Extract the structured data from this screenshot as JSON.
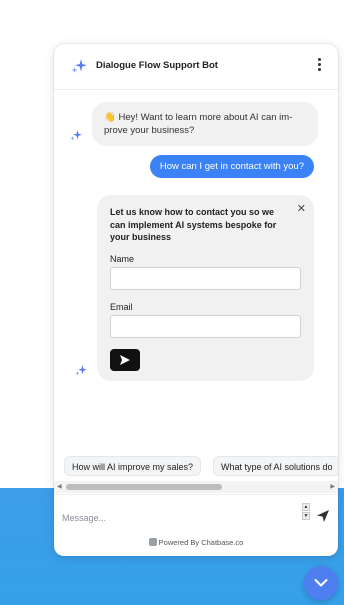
{
  "header": {
    "title": "Dialogue Flow Support Bot",
    "logo_icon": "sparkle-icon",
    "menu_icon": "kebab-menu-icon"
  },
  "messages": {
    "bot_greeting": "👋 Hey! Want to learn more about AI can im-prove your business?",
    "user_message": "How can I get in contact with you?"
  },
  "form": {
    "heading": "Let us know how to contact you so we can implement AI systems bespoke for your business",
    "close_label": "✕",
    "name_label": "Name",
    "name_value": "",
    "email_label": "Email",
    "email_value": ""
  },
  "suggestions": [
    "How will AI improve my sales?",
    "What type of AI solutions do"
  ],
  "composer": {
    "placeholder": "Message..."
  },
  "footer": {
    "powered_by": "Powered By Chatbase.co"
  },
  "colors": {
    "accent": "#3b82f6",
    "background_band": "#3d9de9",
    "fab": "#4f7ef0"
  }
}
